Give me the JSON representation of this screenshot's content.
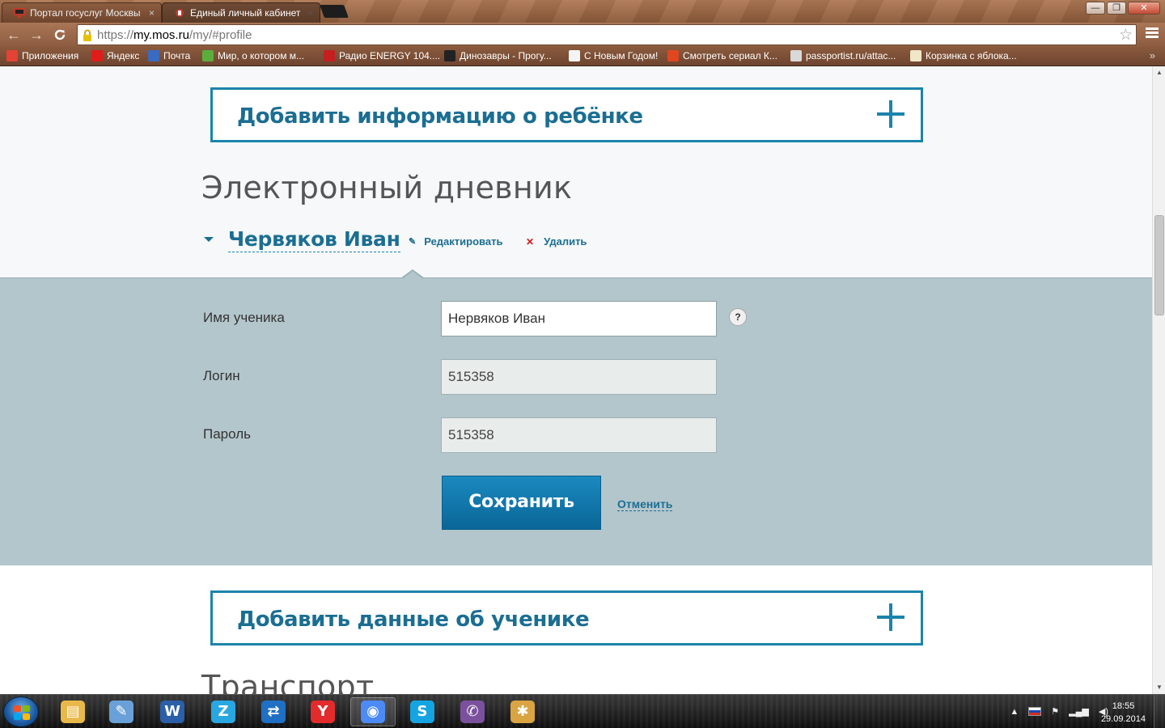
{
  "browser": {
    "tabs": [
      {
        "title": "Портал госуслуг Москвы",
        "close": "×"
      },
      {
        "title": "Единый личный кабинет",
        "close": "×"
      }
    ],
    "window_buttons": {
      "minimize": "—",
      "maximize": "❐",
      "close": "✕"
    },
    "nav": {
      "back": "←",
      "forward": "→",
      "reload": "C"
    },
    "url": {
      "scheme": "https://",
      "host": "my.mos.ru",
      "path": "/my/#profile"
    },
    "star": "☆",
    "bookmarks": [
      {
        "label": "Приложения",
        "icon": "apps-grid-icon",
        "color": "#e34234"
      },
      {
        "label": "Яндекс",
        "icon": "yandex-icon",
        "color": "#e21b1b"
      },
      {
        "label": "Почта",
        "icon": "mail-icon",
        "color": "#3a6bc2"
      },
      {
        "label": "Мир, о котором м...",
        "icon": "bird-icon",
        "color": "#5cae3c"
      },
      {
        "label": "Радио ENERGY 104....",
        "icon": "radio-icon",
        "color": "#c51f1f"
      },
      {
        "label": "Динозавры - Прогу...",
        "icon": "bbc-icon",
        "color": "#222222"
      },
      {
        "label": "С Новым Годом!",
        "icon": "page-icon",
        "color": "#f4f4f4"
      },
      {
        "label": "Смотреть сериал К...",
        "icon": "ctc-icon",
        "color": "#e0461f"
      },
      {
        "label": "passportist.ru/attac...",
        "icon": "bookmark-icon",
        "color": "#d9d9d9"
      },
      {
        "label": "Корзинка с яблока...",
        "icon": "house-icon",
        "color": "#f0e6c8"
      }
    ],
    "bookmarks_more": "»"
  },
  "page": {
    "add_child": "Добавить информацию о ребёнке",
    "diary_title": "Электронный дневник",
    "student": {
      "name": "Червяков Иван",
      "edit_label": "Редактировать",
      "delete_label": "Удалить",
      "pencil": "✎",
      "cross": "✕"
    },
    "form": {
      "name_label": "Имя ученика",
      "name_value": "Нервяков Иван",
      "help": "?",
      "login_label": "Логин",
      "login_value": "515358",
      "password_label": "Пароль",
      "password_value": "515358",
      "save_label": "Сохранить",
      "cancel_label": "Отменить"
    },
    "add_student": "Добавить данные об ученике",
    "transport_title": "Транспорт"
  },
  "taskbar": {
    "apps": [
      {
        "name": "explorer",
        "glyph": "▤",
        "color": "#e8b84a"
      },
      {
        "name": "docs",
        "glyph": "✎",
        "color": "#6aa0d8"
      },
      {
        "name": "word",
        "glyph": "W",
        "color": "#2b5fa8"
      },
      {
        "name": "zoner",
        "glyph": "Z",
        "color": "#29a7e0"
      },
      {
        "name": "teamviewer",
        "glyph": "⇄",
        "color": "#1f6fc4"
      },
      {
        "name": "yandex-browser",
        "glyph": "Y",
        "color": "#e32b2b"
      },
      {
        "name": "chrome",
        "glyph": "◉",
        "color": "#4c8bf5"
      },
      {
        "name": "skype",
        "glyph": "S",
        "color": "#14a4e2"
      },
      {
        "name": "viber",
        "glyph": "✆",
        "color": "#7b519d"
      },
      {
        "name": "paint",
        "glyph": "✱",
        "color": "#d9a441"
      }
    ],
    "tray": {
      "arrow": "▲",
      "signal": "▂▄▆",
      "volume": "◀)"
    },
    "time": "18:55",
    "date": "29.09.2014"
  },
  "colors": {
    "accent": "#1b84ac",
    "accent_text": "#1b6e92",
    "panel": "#b3c6cc",
    "save": "#0f75ab",
    "delete": "#d21a1a"
  }
}
